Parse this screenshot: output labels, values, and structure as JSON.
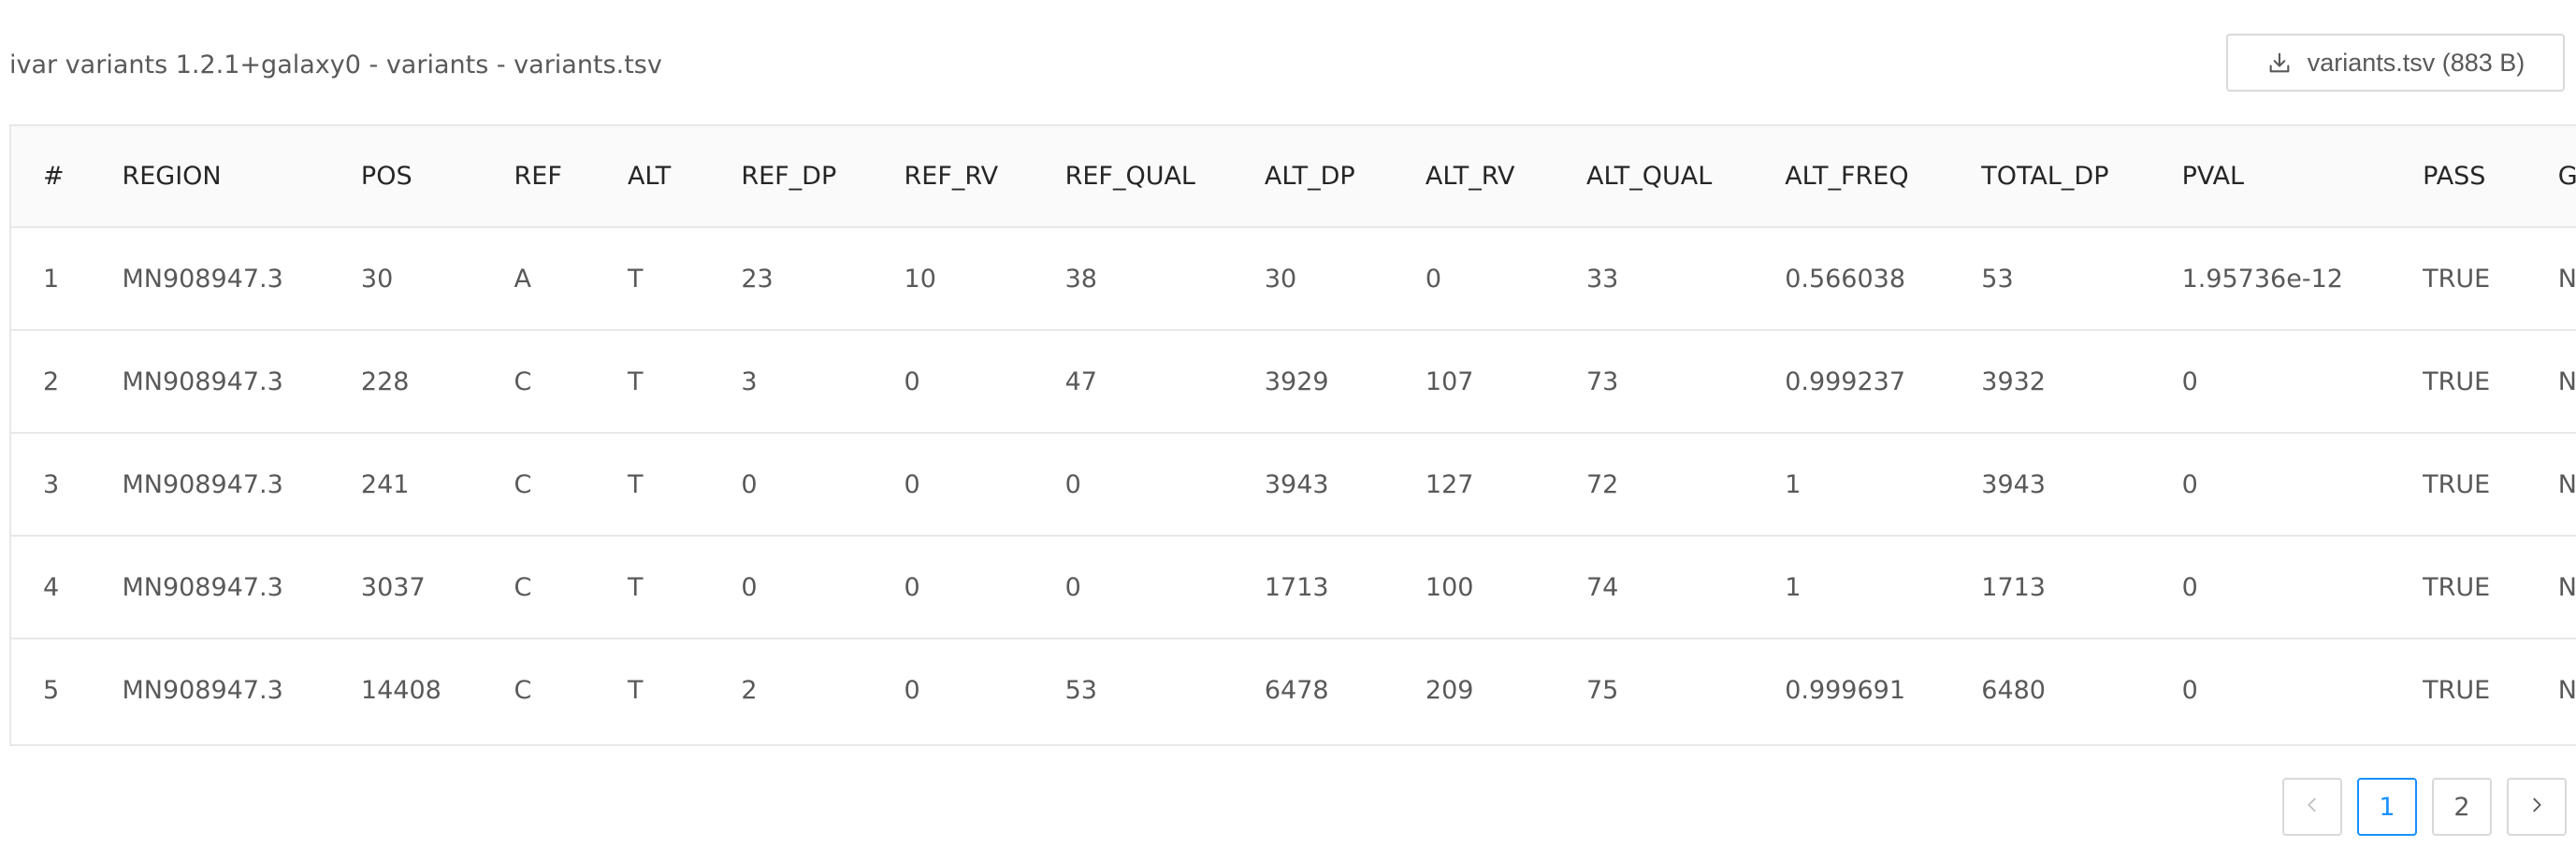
{
  "header": {
    "title": "ivar variants 1.2.1+galaxy0 - variants - variants.tsv",
    "download_label": "variants.tsv (883 B)",
    "download_icon": "download-icon"
  },
  "table": {
    "columns": [
      "#",
      "REGION",
      "POS",
      "REF",
      "ALT",
      "REF_DP",
      "REF_RV",
      "REF_QUAL",
      "ALT_DP",
      "ALT_RV",
      "ALT_QUAL",
      "ALT_FREQ",
      "TOTAL_DP",
      "PVAL",
      "PASS",
      "GFF_FEATURE"
    ],
    "rows": [
      [
        "1",
        "MN908947.3",
        "30",
        "A",
        "T",
        "23",
        "10",
        "38",
        "30",
        "0",
        "33",
        "0.566038",
        "53",
        "1.95736e-12",
        "TRUE",
        "NA"
      ],
      [
        "2",
        "MN908947.3",
        "228",
        "C",
        "T",
        "3",
        "0",
        "47",
        "3929",
        "107",
        "73",
        "0.999237",
        "3932",
        "0",
        "TRUE",
        "NA"
      ],
      [
        "3",
        "MN908947.3",
        "241",
        "C",
        "T",
        "0",
        "0",
        "0",
        "3943",
        "127",
        "72",
        "1",
        "3943",
        "0",
        "TRUE",
        "NA"
      ],
      [
        "4",
        "MN908947.3",
        "3037",
        "C",
        "T",
        "0",
        "0",
        "0",
        "1713",
        "100",
        "74",
        "1",
        "1713",
        "0",
        "TRUE",
        "NA"
      ],
      [
        "5",
        "MN908947.3",
        "14408",
        "C",
        "T",
        "2",
        "0",
        "53",
        "6478",
        "209",
        "75",
        "0.999691",
        "6480",
        "0",
        "TRUE",
        "NA"
      ]
    ]
  },
  "pagination": {
    "prev_icon": "chevron-left-icon",
    "pages": [
      "1",
      "2"
    ],
    "current": "1",
    "next_icon": "chevron-right-icon"
  },
  "colors": {
    "accent": "#1890ff",
    "border": "#e8e8e8",
    "header_bg": "#fafafa"
  }
}
